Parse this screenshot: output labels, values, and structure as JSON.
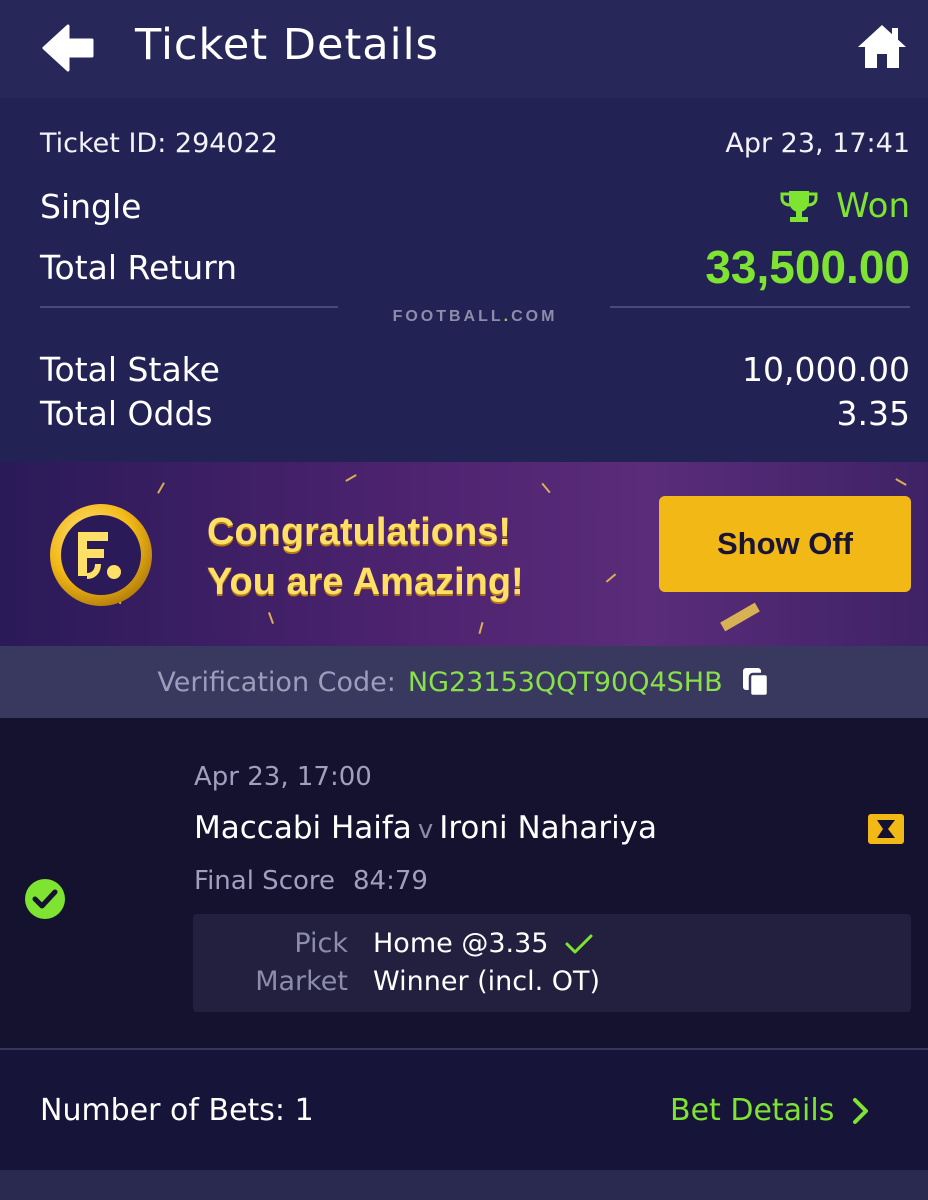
{
  "header": {
    "title": "Ticket Details",
    "back_icon": "back-arrow-icon",
    "home_icon": "home-icon"
  },
  "ticket": {
    "id_label": "Ticket ID: 294022",
    "datetime": "Apr 23, 17:41",
    "type": "Single",
    "status": "Won",
    "total_return_label": "Total Return",
    "total_return_value": "33,500.00",
    "brand_left": "FOOTBALL",
    "brand_dot": ".",
    "brand_right": "COM",
    "total_stake_label": "Total Stake",
    "total_stake_value": "10,000.00",
    "total_odds_label": "Total Odds",
    "total_odds_value": "3.35"
  },
  "banner": {
    "line1": "Congratulations!",
    "line2": "You are Amazing!",
    "button": "Show Off"
  },
  "verification": {
    "label": "Verification Code:",
    "code": "NG23153QQT90Q4SHB"
  },
  "bet": {
    "date": "Apr 23, 17:00",
    "home": "Maccabi Haifa",
    "vs": "v",
    "away": "Ironi Nahariya",
    "final_label": "Final Score",
    "final_score": "84:79",
    "pick_label": "Pick",
    "pick_value": "Home @3.35",
    "market_label": "Market",
    "market_value": "Winner (incl. OT)"
  },
  "footer": {
    "num_bets": "Number of Bets: 1",
    "bet_details": "Bet Details"
  },
  "colors": {
    "accent_green": "#7ee331",
    "button_yellow": "#f2b816",
    "header_bg": "#28275a"
  }
}
